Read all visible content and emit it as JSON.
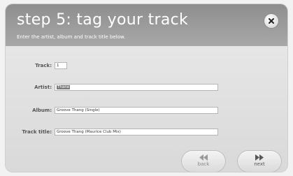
{
  "header": {
    "title": "step 5: tag your track",
    "instructions": "Enter the artist, album and track title below."
  },
  "fields": {
    "track": {
      "label": "Track:",
      "value": "1"
    },
    "artist": {
      "label": "Artist:",
      "value": "Thane"
    },
    "album": {
      "label": "Album:",
      "value": "Groove Thang (Single)"
    },
    "title": {
      "label": "Track title:",
      "value": "Groove Thang (Maurice Club Mix)"
    }
  },
  "nav": {
    "back_label": "back",
    "next_label": "next"
  },
  "icons": {
    "close": "close-icon",
    "back": "rewind-arrows-icon",
    "next": "forward-arrows-icon"
  },
  "colors": {
    "header_bg": "#9b9b9b",
    "body_bg": "#dedede",
    "title_text": "#ffffff"
  }
}
